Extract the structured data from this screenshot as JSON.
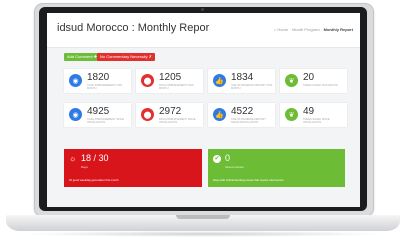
{
  "header": {
    "title": "idsud Morocco : Monthly Repor",
    "breadcrumb": [
      "⌂ Home",
      "Month Program",
      "Monthly Report"
    ]
  },
  "buttons": {
    "add_comment": "Add Comment ✚",
    "no_commentary": "No Commentary Necessity ✗"
  },
  "stats": [
    {
      "value": "1820",
      "label": "Cash disbursement this month",
      "icon": "camera-icon",
      "color": "#2f7be6"
    },
    {
      "value": "1205",
      "label": "Pass disbursement this month",
      "icon": "map-pin-icon",
      "color": "#e0312e"
    },
    {
      "value": "1834",
      "label": "Use of reserve deposit this month",
      "icon": "thumbs-up-icon",
      "color": "#2f7be6"
    },
    {
      "value": "20",
      "label": "Trees saved this month",
      "icon": "leaf-icon",
      "color": "#6dbc35"
    },
    {
      "value": "4925",
      "label": "Cash disbursement since installation",
      "icon": "camera-icon",
      "color": "#2f7be6"
    },
    {
      "value": "2972",
      "label": "Pass disbursement since installation",
      "icon": "map-pin-icon",
      "color": "#e0312e"
    },
    {
      "value": "4522",
      "label": "Use of reserve deposit since installation",
      "icon": "thumbs-up-icon",
      "color": "#2f7be6"
    },
    {
      "value": "49",
      "label": "Trees saved since installation",
      "icon": "leaf-icon",
      "color": "#6dbc35"
    }
  ],
  "banners": {
    "red": {
      "big": "18 / 30",
      "sub": "Days",
      "foot": "Of good weekday generation this month"
    },
    "green": {
      "big": "0",
      "sub": "Severe issues",
      "foot": "Days with critical blocking issues that require intervention"
    }
  }
}
